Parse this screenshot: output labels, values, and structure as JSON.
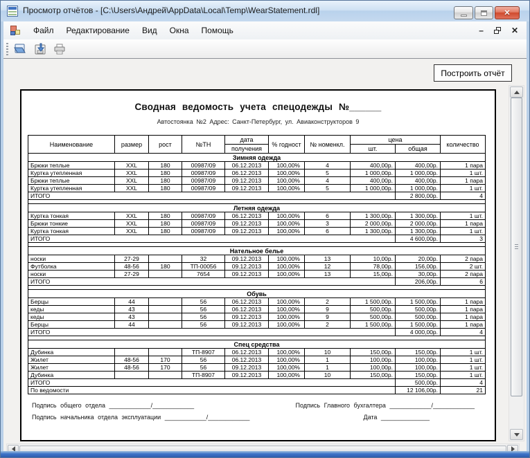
{
  "window": {
    "title": "Просмотр отчётов - [C:\\Users\\Андрей\\AppData\\Local\\Temp\\WearStatement.rdl]",
    "caption_buttons": [
      "minimize",
      "maximize",
      "close"
    ],
    "frame_color": "#b9d0e8",
    "frame_bottom_color": "#3e74c8"
  },
  "menu": {
    "items": [
      "Файл",
      "Редактирование",
      "Вид",
      "Окна",
      "Помощь"
    ],
    "child_controls": {
      "minimize": "–",
      "restore": "restore-icon",
      "close": "✕"
    }
  },
  "toolbar": {
    "icons": [
      {
        "name": "open-icon"
      },
      {
        "name": "save-icon"
      },
      {
        "name": "print-icon"
      }
    ]
  },
  "build_button_label": "Построить отчёт",
  "report": {
    "title": "Сводная ведомость учета спецодежды №______",
    "subtitle": "Автостоянка №2  Адрес: Санкт-Петербург, ул. Авиаконструкторов 9",
    "table": {
      "headers": {
        "name": "Наименование",
        "size": "размер",
        "height": "рост",
        "tn": "№ТН",
        "date_top": "дата",
        "date_bottom": "получения",
        "percent": "% годност",
        "nomenkl": "№ номенкл.",
        "price": "цена",
        "price_unit": "шт.",
        "price_total": "общая",
        "qty": "количество"
      },
      "sections": [
        {
          "name": "Зимняя одежда",
          "rows": [
            [
              "Брюки теплые",
              "XXL",
              "180",
              "00987/09",
              "06.12.2013",
              "100,00%",
              "4",
              "400,00р.",
              "400,00р.",
              "1 пара"
            ],
            [
              "Куртка утепленная",
              "XXL",
              "180",
              "00987/09",
              "06.12.2013",
              "100,00%",
              "5",
              "1 000,00р.",
              "1 000,00р.",
              "1 шт."
            ],
            [
              "Брюки теплые",
              "XXL",
              "180",
              "00987/09",
              "09.12.2013",
              "100,00%",
              "4",
              "400,00р.",
              "400,00р.",
              "1 пара"
            ],
            [
              "Куртка утепленная",
              "XXL",
              "180",
              "00987/09",
              "09.12.2013",
              "100,00%",
              "5",
              "1 000,00р.",
              "1 000,00р.",
              "1 шт."
            ]
          ],
          "total": {
            "label": "ИТОГО",
            "sum": "2 800,00р.",
            "count": "4"
          }
        },
        {
          "name": "Летняя одежда",
          "rows": [
            [
              "Куртка тонкая",
              "XXL",
              "180",
              "00987/09",
              "06.12.2013",
              "100,00%",
              "6",
              "1 300,00р.",
              "1 300,00р.",
              "1 шт."
            ],
            [
              "Брюки тонкие",
              "XXL",
              "180",
              "00987/09",
              "09.12.2013",
              "100,00%",
              "3",
              "2 000,00р.",
              "2 000,00р.",
              "1 пара"
            ],
            [
              "Куртка тонкая",
              "XXL",
              "180",
              "00987/09",
              "09.12.2013",
              "100,00%",
              "6",
              "1 300,00р.",
              "1 300,00р.",
              "1 шт."
            ]
          ],
          "total": {
            "label": "ИТОГО",
            "sum": "4 600,00р.",
            "count": "3"
          }
        },
        {
          "name": "Нательное белье",
          "rows": [
            [
              "носки",
              "27-29",
              "",
              "32",
              "09.12.2013",
              "100,00%",
              "13",
              "10,00р.",
              "20,00р.",
              "2 пара"
            ],
            [
              "Футболка",
              "48-56",
              "180",
              "ТП-00056",
              "09.12.2013",
              "100,00%",
              "12",
              "78,00р.",
              "156,00р.",
              "2 шт."
            ],
            [
              "носки",
              "27-29",
              "",
              "7654",
              "09.12.2013",
              "100,00%",
              "13",
              "15,00р.",
              "30,00р.",
              "2 пара"
            ]
          ],
          "total": {
            "label": "ИТОГО",
            "sum": "206,00р.",
            "count": "6"
          }
        },
        {
          "name": "Обувь",
          "rows": [
            [
              "Берцы",
              "44",
              "",
              "56",
              "06.12.2013",
              "100,00%",
              "2",
              "1 500,00р.",
              "1 500,00р.",
              "1 пара"
            ],
            [
              "кеды",
              "43",
              "",
              "56",
              "06.12.2013",
              "100,00%",
              "9",
              "500,00р.",
              "500,00р.",
              "1 пара"
            ],
            [
              "кеды",
              "43",
              "",
              "56",
              "09.12.2013",
              "100,00%",
              "9",
              "500,00р.",
              "500,00р.",
              "1 пара"
            ],
            [
              "Берцы",
              "44",
              "",
              "56",
              "09.12.2013",
              "100,00%",
              "2",
              "1 500,00р.",
              "1 500,00р.",
              "1 пара"
            ]
          ],
          "total": {
            "label": "ИТОГО",
            "sum": "4 000,00р.",
            "count": "4"
          }
        },
        {
          "name": "Спец средства",
          "rows": [
            [
              "Дубинка",
              "",
              "",
              "ТП-8907",
              "06.12.2013",
              "100,00%",
              "10",
              "150,00р.",
              "150,00р.",
              "1 шт."
            ],
            [
              "Жилет",
              "48-56",
              "170",
              "56",
              "06.12.2013",
              "100,00%",
              "1",
              "100,00р.",
              "100,00р.",
              "1 шт."
            ],
            [
              "Жилет",
              "48-56",
              "170",
              "56",
              "09.12.2013",
              "100,00%",
              "1",
              "100,00р.",
              "100,00р.",
              "1 шт."
            ],
            [
              "Дубинка",
              "",
              "",
              "ТП-8907",
              "09.12.2013",
              "100,00%",
              "10",
              "150,00р.",
              "150,00р.",
              "1 шт."
            ]
          ],
          "total": {
            "label": "ИТОГО",
            "sum": "500,00р.",
            "count": "4"
          }
        }
      ],
      "grand_total": {
        "label": "По ведомости",
        "sum": "12 106,00р.",
        "count": "21"
      }
    },
    "signatures": {
      "row1_left_label": "Подпись общего отдела",
      "row1_left_line": "____________/____________",
      "row1_right_label": "Подпись Главного бухгалтера",
      "row1_right_line": "____________/____________",
      "row2_left_label": "Подпись начальника отдела эксплуатации",
      "row2_left_line": "____________/____________",
      "row2_right_label": "Дата",
      "row2_right_line": "______________"
    }
  }
}
